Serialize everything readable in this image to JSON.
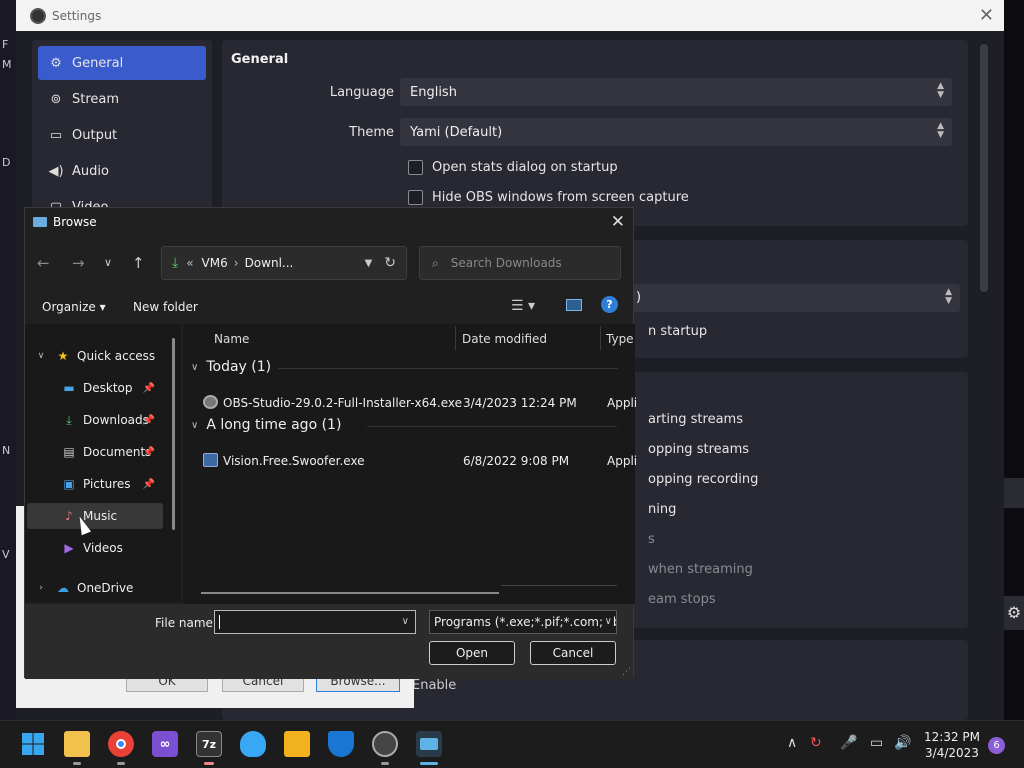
{
  "desktop": {
    "left_letters": [
      "F",
      "M",
      "D",
      "N",
      "V"
    ]
  },
  "settings": {
    "title": "Settings",
    "nav": [
      {
        "label": "General",
        "icon": "gear-icon",
        "active": true
      },
      {
        "label": "Stream",
        "icon": "antenna-icon"
      },
      {
        "label": "Output",
        "icon": "monitor-icon"
      },
      {
        "label": "Audio",
        "icon": "speaker-icon"
      },
      {
        "label": "Video",
        "icon": "video-icon"
      }
    ],
    "general": {
      "section_title": "General",
      "language_label": "Language",
      "language_value": "English",
      "theme_label": "Theme",
      "theme_value": "Yami (Default)",
      "open_stats_label": "Open stats dialog on startup",
      "hide_obs_label": "Hide OBS windows from screen capture"
    },
    "panel2": {
      "select_value_fragment": ")",
      "text_fragment": "n startup"
    },
    "panel3": {
      "options": [
        {
          "text": "arting streams",
          "dim": false
        },
        {
          "text": "opping streams",
          "dim": false
        },
        {
          "text": "opping recording",
          "dim": false
        },
        {
          "text": "ning",
          "dim": false
        },
        {
          "text": "s",
          "dim": true
        },
        {
          "text": "when streaming",
          "dim": true
        },
        {
          "text": "eam stops",
          "dim": true
        }
      ]
    },
    "panel4": {
      "enable_label": "Enable"
    },
    "under_buttons": {
      "ok": "OK",
      "cancel": "Cancel",
      "browse": "Browse..."
    }
  },
  "browse": {
    "title": "Browse",
    "address": {
      "prefix": "«",
      "segment1": "VM6",
      "separator": "›",
      "segment2": "Downl..."
    },
    "search_placeholder": "Search Downloads",
    "toolbar": {
      "organize": "Organize ▾",
      "new_folder": "New folder"
    },
    "tree": {
      "quick_access": "Quick access",
      "items": [
        {
          "label": "Desktop",
          "pinned": true
        },
        {
          "label": "Downloads",
          "pinned": true
        },
        {
          "label": "Documents",
          "pinned": true
        },
        {
          "label": "Pictures",
          "pinned": true
        },
        {
          "label": "Music",
          "pinned": false
        },
        {
          "label": "Videos",
          "pinned": false
        }
      ],
      "onedrive": "OneDrive"
    },
    "columns": {
      "name": "Name",
      "date_modified": "Date modified",
      "type": "Type"
    },
    "groups": [
      {
        "header": "Today (1)",
        "files": [
          {
            "name": "OBS-Studio-29.0.2-Full-Installer-x64.exe",
            "date": "3/4/2023 12:24 PM",
            "type": "Appli"
          }
        ]
      },
      {
        "header": "A long time ago (1)",
        "files": [
          {
            "name": "Vision.Free.Swoofer.exe",
            "date": "6/8/2022 9:08 PM",
            "type": "Appli"
          }
        ]
      }
    ],
    "file_name_label": "File name:",
    "file_name_value": "",
    "file_type_value": "Programs (*.exe;*.pif;*.com;*.ba",
    "open_button": "Open",
    "cancel_button": "Cancel"
  },
  "taskbar": {
    "apps": [
      {
        "name": "start",
        "glyph": "",
        "color": "#1e90ff"
      },
      {
        "name": "file-explorer",
        "glyph": "",
        "color": "#f0c24b"
      },
      {
        "name": "chrome",
        "glyph": "",
        "color": "#e94235"
      },
      {
        "name": "visual-studio",
        "glyph": "",
        "color": "#7a4fd1"
      },
      {
        "name": "7zip",
        "glyph": "7z",
        "color": "#333333"
      },
      {
        "name": "tips",
        "glyph": "",
        "color": "#38a8f5"
      },
      {
        "name": "store",
        "glyph": "",
        "color": "#f2b21d"
      },
      {
        "name": "defender",
        "glyph": "",
        "color": "#1976d2"
      },
      {
        "name": "obs",
        "glyph": "",
        "color": "#444444"
      },
      {
        "name": "browse-dialog",
        "glyph": "",
        "color": "#5fb3e4"
      }
    ],
    "clock_time": "12:32 PM",
    "clock_date": "3/4/2023",
    "notification_count": "6"
  }
}
